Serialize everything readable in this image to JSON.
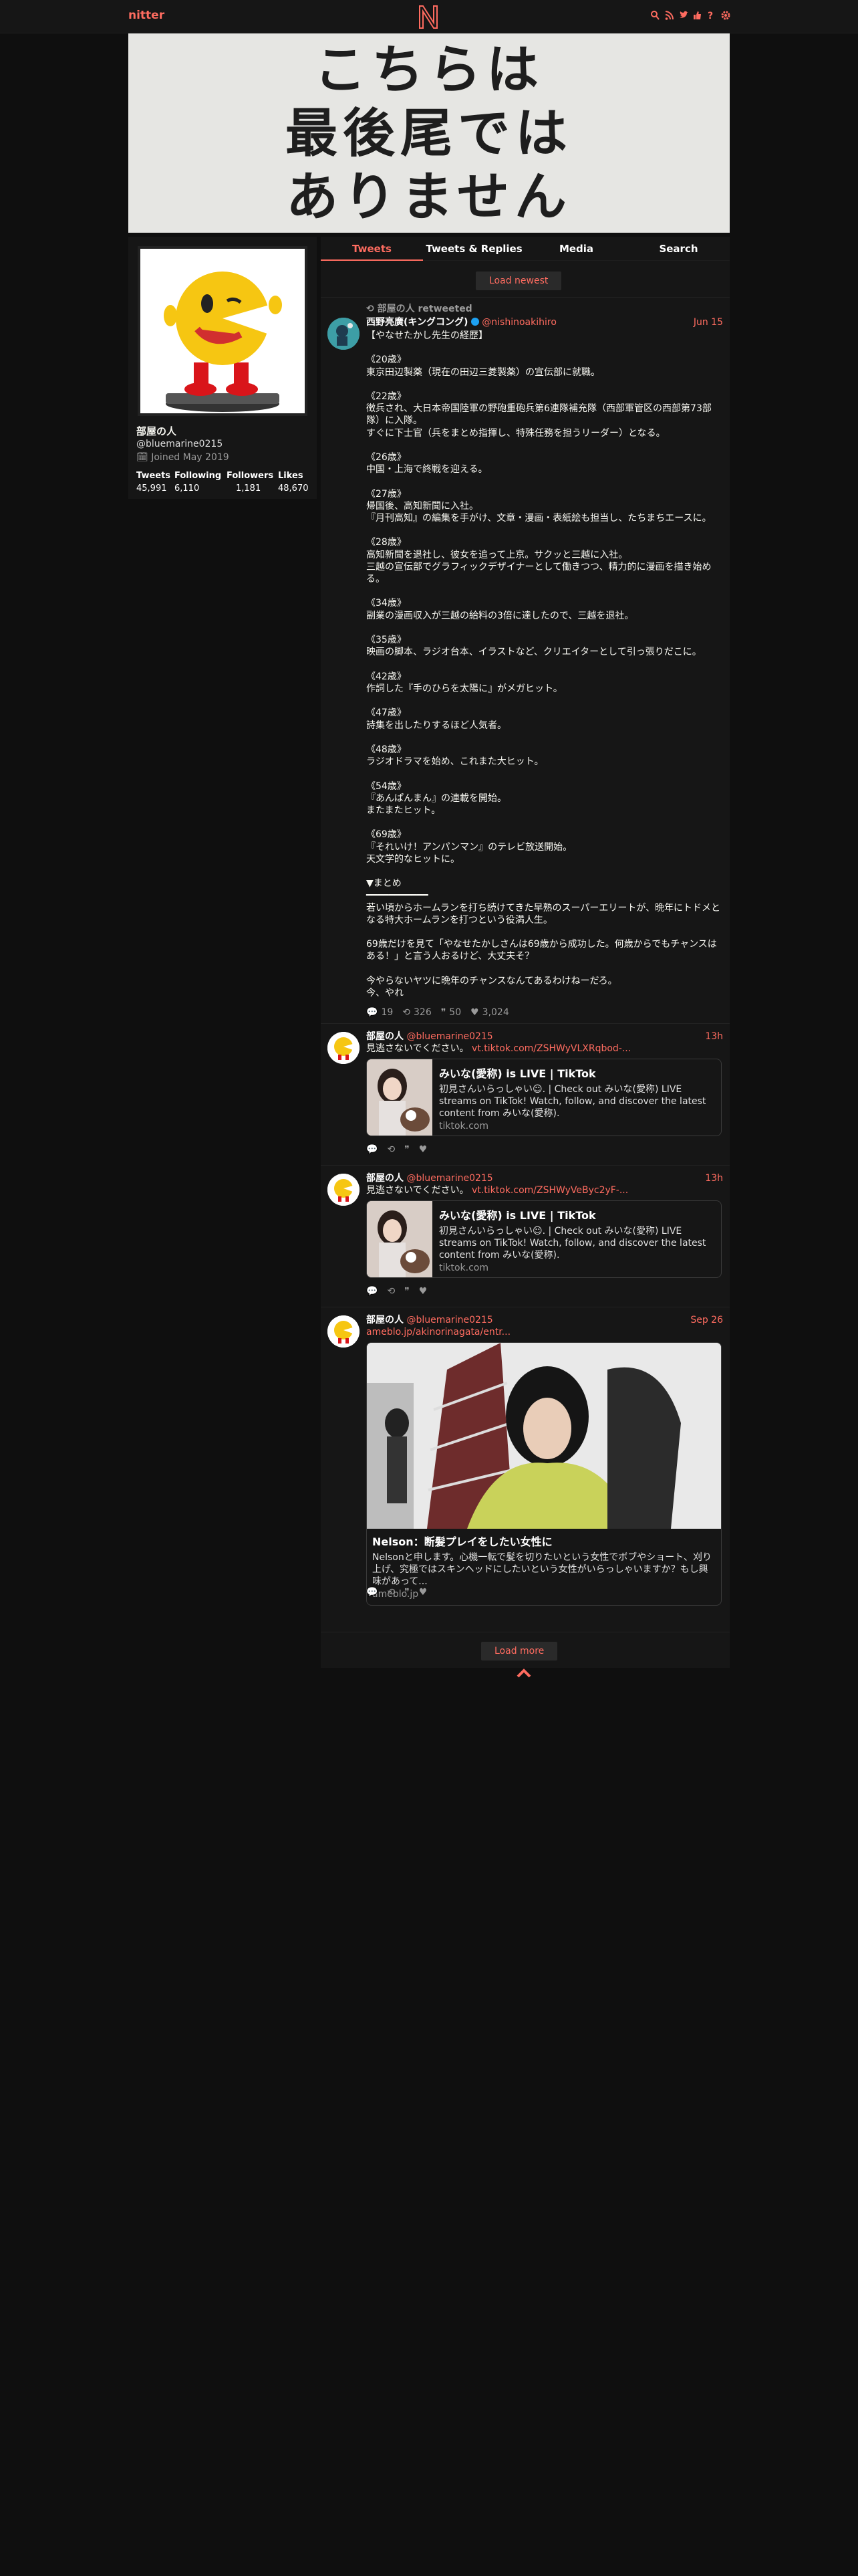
{
  "nav": {
    "brand": "nitter",
    "icons": [
      "search-icon",
      "rss-icon",
      "twitter-icon",
      "thumbs-up-icon",
      "question-icon",
      "gear-icon"
    ],
    "accent": "#ff6c60"
  },
  "banner": {
    "text": "こちらは\n最後尾では\nありません"
  },
  "profile": {
    "fullname": "部屋の人",
    "username": "@bluemarine0215",
    "joined": "Joined May 2019",
    "stats": [
      {
        "label": "Tweets",
        "value": "45,991"
      },
      {
        "label": "Following",
        "value": "6,110"
      },
      {
        "label": "Followers",
        "value": "1,181"
      },
      {
        "label": "Likes",
        "value": "48,670"
      }
    ]
  },
  "tabs": [
    {
      "label": "Tweets",
      "active": true
    },
    {
      "label": "Tweets & Replies",
      "active": false
    },
    {
      "label": "Media",
      "active": false
    },
    {
      "label": "Search",
      "active": false
    }
  ],
  "load_newest": "Load newest",
  "load_more": "Load more",
  "tweets": [
    {
      "retweet": "部屋の人 retweeted",
      "name": "西野亮廣(キングコング)",
      "username": "@nishinoakihiro",
      "date": "Jun 15",
      "text": "【やなせたかし先生の経歴】\n\n《20歳》\n東京田辺製薬（現在の田辺三菱製薬）の宣伝部に就職。\n\n《22歳》\n徴兵され、大日本帝国陸軍の野砲重砲兵第6連隊補充隊（西部軍管区の西部第73部隊）に入隊。\nすぐに下士官（兵をまとめ指揮し、特殊任務を担うリーダー）となる。\n\n《26歳》\n中国・上海で終戦を迎える。\n\n《27歳》\n帰国後、高知新聞に入社。\n『月刊高知』の編集を手がけ、文章・漫画・表紙絵も担当し、たちまちエースに。\n\n《28歳》\n高知新聞を退社し、彼女を追って上京。サクッと三越に入社。\n三越の宣伝部でグラフィックデザイナーとして働きつつ、精力的に漫画を描き始める。\n\n《34歳》\n副業の漫画収入が三越の給料の3倍に達したので、三越を退社。\n\n《35歳》\n映画の脚本、ラジオ台本、イラストなど、クリエイターとして引っ張りだこに。\n\n《42歳》\n作詞した『手のひらを太陽に』がメガヒット。\n\n《47歳》\n詩集を出したりするほど人気者。\n\n《48歳》\nラジオドラマを始め、これまた大ヒット。\n\n《54歳》\n『あんぱんまん』の連載を開始。\nまたまたヒット。\n\n《69歳》\n『それいけ！アンパンマン』のテレビ放送開始。\n天文学的なヒットに。\n\n▼まとめ\n━━━━━━━━━━━\n若い頃からホームランを打ち続けてきた早熟のスーパーエリートが、晩年にトドメとなる特大ホームランを打つという役満人生。\n\n69歳だけを見て「やなせたかしさんは69歳から成功した。何歳からでもチャンスはある！」と言う人おるけど、大丈夫そ？\n\n今やらないヤツに晩年のチャンスなんてあるわけねーだろ。\n今、やれ",
      "replies": "19",
      "retweets": "326",
      "quotes": "50",
      "likes": "3,024"
    },
    {
      "name": "部屋の人",
      "username": "@bluemarine0215",
      "date": "13h",
      "text": "見逃さないでください。",
      "link": "vt.tiktok.com/ZSHWyVLXRqbod-...",
      "card_title": "みいな(愛称) is LIVE | TikTok",
      "card_desc": "初見さんいらっしゃい☺︎. | Check out みいな(愛称) LIVE streams on TikTok! Watch, follow, and discover the latest content from みいな(愛称).",
      "card_dest": "tiktok.com"
    },
    {
      "name": "部屋の人",
      "username": "@bluemarine0215",
      "date": "13h",
      "text": "見逃さないでください。",
      "link": "vt.tiktok.com/ZSHWyVeByc2yF-...",
      "card_title": "みいな(愛称) is LIVE | TikTok",
      "card_desc": "初見さんいらっしゃい☺︎. | Check out みいな(愛称) LIVE streams on TikTok! Watch, follow, and discover the latest content from みいな(愛称).",
      "card_dest": "tiktok.com"
    },
    {
      "name": "部屋の人",
      "username": "@bluemarine0215",
      "date": "Sep 26",
      "link": "ameblo.jp/akinorinagata/entr...",
      "card_title": "Nelson：断髪プレイをしたい女性に",
      "card_desc": "Nelsonと申します。心機一転で髪を切りたいという女性でボブやショート、刈り上げ、究極ではスキンヘッドにしたいという女性がいらっしゃいますか？もし興味があって...",
      "card_dest": "ameblo.jp"
    }
  ]
}
